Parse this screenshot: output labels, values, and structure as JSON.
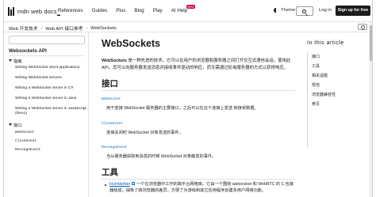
{
  "header": {
    "logo_text": "mdn web docs",
    "logo_suffix": "_",
    "nav": [
      "References",
      "Guides",
      "Plus",
      "Blog",
      "Play"
    ],
    "ai_help": "AI Help",
    "ai_badge": "NEW",
    "theme_label": "Theme",
    "login": "Log in",
    "signup": "Sign up for free"
  },
  "breadcrumb": [
    "Web 开发技术",
    "Web API 接口参考",
    "WebSockets"
  ],
  "sidebar": {
    "title": "Websockets API",
    "group1": "指南",
    "guides": [
      "Writing WebSocket client applications",
      "Writing WebSocket servers",
      "Writing a WebSocket server in C#",
      "Writing a WebSocket server in Java",
      "Writing a WebSocket server in JavaScript (Deno)"
    ],
    "group2": "接口",
    "interfaces": [
      "WebSocket",
      "CloseEvent",
      "MessageEvent"
    ]
  },
  "main": {
    "title": "WebSockets",
    "intro_bold": "WebSockets",
    "intro_rest": " 是一种先进的技术。它可以在用户的浏览器和服务器之间打开交互式通信会话。使用此 API，您可以向服务器发送消息并接收事件驱动的响应，而无需通过轮询服务器的方式以获得响应。",
    "section_interfaces": "接口",
    "items": [
      {
        "term": "WebSocket",
        "desc": "用于连接 WebSocket 服务器的主要接口，之后可以在这个连接上发送 和接受数据。"
      },
      {
        "term": "CloseEvent",
        "desc": "连接关闭时 WebSocket 对象发送的事件。"
      },
      {
        "term": "MessageEvent",
        "desc": "当从服务器获取到消息的时候 WebSocket 对象触发的事件。"
      }
    ],
    "section_tools": "工具",
    "tools": [
      {
        "link": "HumbleNet",
        "text": "一个在浏览器中工作的跨平台网络库。它由一个围绕 websocket 和 WebRTC 的 C 包装器组成，抽象了跨浏览器的差异，方便了为游戏和其它应用程序创建多用户网络功能。"
      }
    ]
  },
  "toc": {
    "title": "In this article",
    "items": [
      "接口",
      "工具",
      "相关话题",
      "规范",
      "浏览器兼容性",
      "参见"
    ]
  }
}
